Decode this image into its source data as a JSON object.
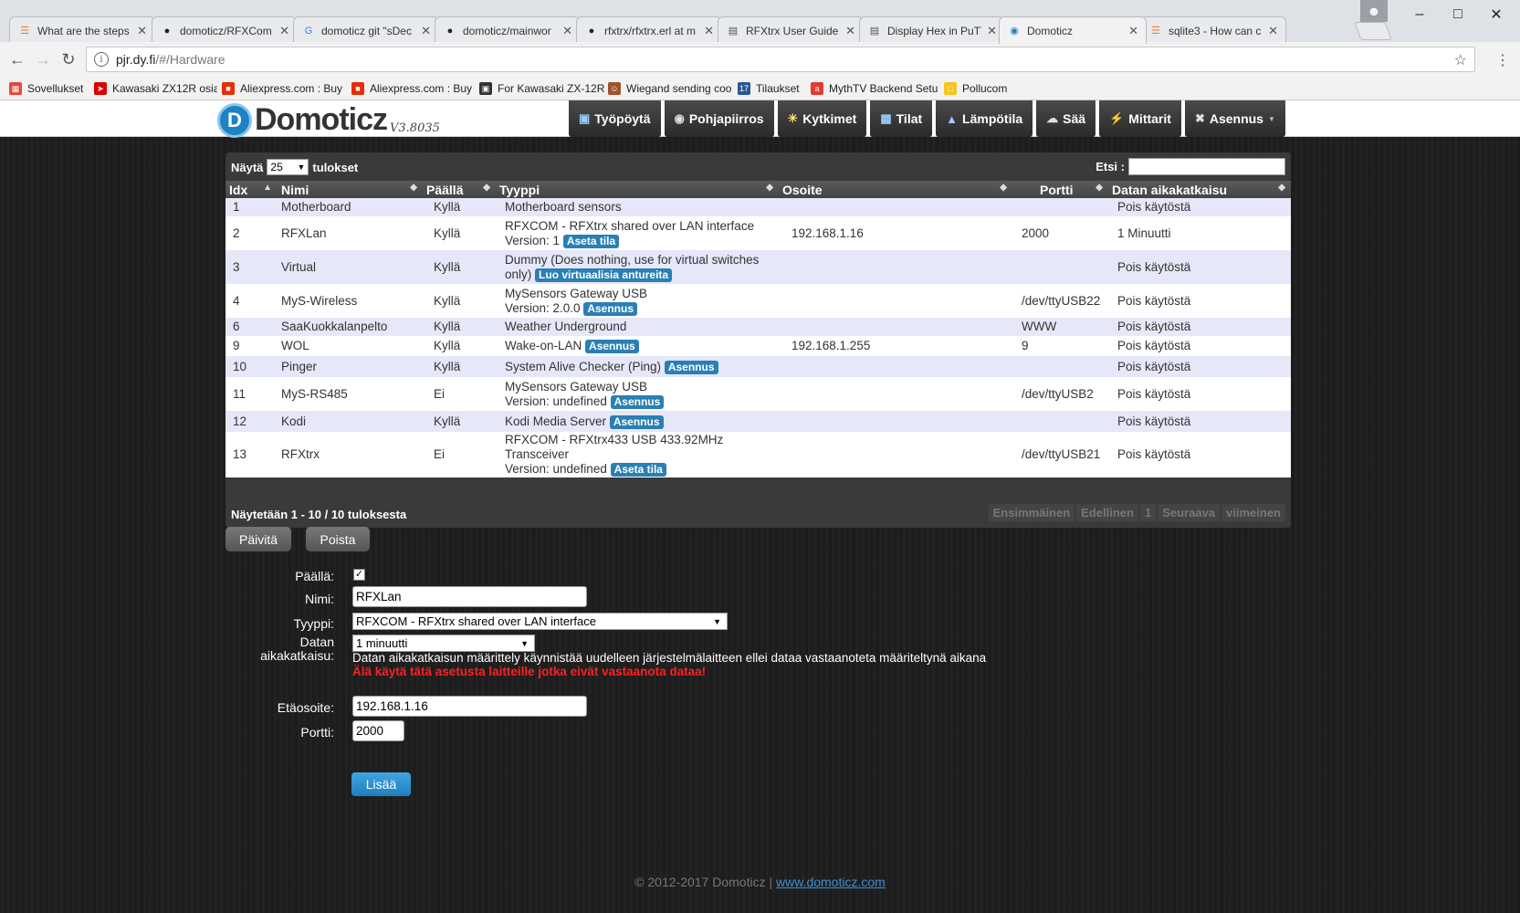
{
  "browser": {
    "tabs": [
      {
        "title": "What are the steps",
        "icon": "stackoverflow-icon"
      },
      {
        "title": "domoticz/RFXCom",
        "icon": "github-icon"
      },
      {
        "title": "domoticz git \"sDec",
        "icon": "google-icon"
      },
      {
        "title": "domoticz/mainwor",
        "icon": "github-icon"
      },
      {
        "title": "rfxtrx/rfxtrx.erl at m",
        "icon": "github-icon"
      },
      {
        "title": "RFXtrx User Guide",
        "icon": "document-icon"
      },
      {
        "title": "Display Hex in PuTT",
        "icon": "document-icon"
      },
      {
        "title": "Domoticz",
        "icon": "domoticz-icon"
      },
      {
        "title": "sqlite3 - How can c",
        "icon": "stackoverflow-icon"
      }
    ],
    "url_host": "pjr.dy.fi",
    "url_path": "/#/Hardware",
    "bookmarks": [
      {
        "label": "Sovellukset",
        "icon": "apps-grid-icon"
      },
      {
        "label": "Kawasaki ZX12R osia",
        "icon": "motorcycle-icon"
      },
      {
        "label": "Aliexpress.com : Buy",
        "icon": "aliexpress-icon"
      },
      {
        "label": "Aliexpress.com : Buy",
        "icon": "aliexpress-icon"
      },
      {
        "label": "For Kawasaki ZX-12R",
        "icon": "shop-icon"
      },
      {
        "label": "Wiegand sending coo",
        "icon": "person-icon"
      },
      {
        "label": "Tilaukset",
        "icon": "calendar-icon"
      },
      {
        "label": "MythTV Backend Setu",
        "icon": "ask-icon"
      },
      {
        "label": "Pollucom",
        "icon": "folder-icon"
      }
    ]
  },
  "app": {
    "logo_text": "Domoticz",
    "version": "V3.8035",
    "nav": [
      {
        "label": "Työpöytä",
        "icon": "dashboard-icon"
      },
      {
        "label": "Pohjapiirros",
        "icon": "floorplan-icon"
      },
      {
        "label": "Kytkimet",
        "icon": "lightbulb-icon"
      },
      {
        "label": "Tilat",
        "icon": "scene-icon"
      },
      {
        "label": "Lämpötila",
        "icon": "thermometer-icon"
      },
      {
        "label": "Sää",
        "icon": "weather-icon"
      },
      {
        "label": "Mittarit",
        "icon": "lightning-icon"
      },
      {
        "label": "Asennus",
        "icon": "tools-icon"
      }
    ]
  },
  "table": {
    "show_prefix": "Näytä",
    "page_size": "25",
    "show_suffix": "tulokset",
    "search_label": "Etsi :",
    "columns": [
      "Idx",
      "Nimi",
      "Päällä",
      "Tyyppi",
      "Osoite",
      "Portti",
      "Datan aikakatkaisu"
    ],
    "rows": [
      {
        "idx": "1",
        "name": "Motherboard",
        "enabled": "Kyllä",
        "type": "Motherboard sensors",
        "type2": "",
        "badge": "",
        "address": "",
        "port": "",
        "timeout": "Pois käytöstä"
      },
      {
        "idx": "2",
        "name": "RFXLan",
        "enabled": "Kyllä",
        "type": "RFXCOM - RFXtrx shared over LAN interface",
        "type2": "Version: 1",
        "badge": "Aseta tila",
        "address": "192.168.1.16",
        "port": "2000",
        "timeout": "1 Minuutti"
      },
      {
        "idx": "3",
        "name": "Virtual",
        "enabled": "Kyllä",
        "type": "Dummy (Does nothing, use for virtual switches",
        "type2": "only)",
        "badge": "Luo virtuaalisia antureita",
        "address": "",
        "port": "",
        "timeout": "Pois käytöstä"
      },
      {
        "idx": "4",
        "name": "MyS-Wireless",
        "enabled": "Kyllä",
        "type": "MySensors Gateway USB",
        "type2": "Version: 2.0.0",
        "badge": "Asennus",
        "address": "",
        "port": "/dev/ttyUSB22",
        "timeout": "Pois käytöstä"
      },
      {
        "idx": "6",
        "name": "SaaKuokkalanpelto",
        "enabled": "Kyllä",
        "type": "Weather Underground",
        "type2": "",
        "badge": "",
        "address": "",
        "port": "WWW",
        "timeout": "Pois käytöstä"
      },
      {
        "idx": "9",
        "name": "WOL",
        "enabled": "Kyllä",
        "type": "Wake-on-LAN",
        "type2": "",
        "badge": "Asennus",
        "address": "192.168.1.255",
        "port": "9",
        "timeout": "Pois käytöstä"
      },
      {
        "idx": "10",
        "name": "Pinger",
        "enabled": "Kyllä",
        "type": "System Alive Checker (Ping)",
        "type2": "",
        "badge": "Asennus",
        "address": "",
        "port": "",
        "timeout": "Pois käytöstä"
      },
      {
        "idx": "11",
        "name": "MyS-RS485",
        "enabled": "Ei",
        "type": "MySensors Gateway USB",
        "type2": "Version: undefined",
        "badge": "Asennus",
        "address": "",
        "port": "/dev/ttyUSB2",
        "timeout": "Pois käytöstä"
      },
      {
        "idx": "12",
        "name": "Kodi",
        "enabled": "Kyllä",
        "type": "Kodi Media Server",
        "type2": "",
        "badge": "Asennus",
        "address": "",
        "port": "",
        "timeout": "Pois käytöstä"
      },
      {
        "idx": "13",
        "name": "RFXtrx",
        "enabled": "Ei",
        "type": "RFXCOM - RFXtrx433 USB 433.92MHz",
        "type2": "Transceiver",
        "type3": "Version: undefined",
        "badge": "Aseta tila",
        "address": "",
        "port": "/dev/ttyUSB21",
        "timeout": "Pois käytöstä"
      }
    ],
    "info": "Näytetään 1 - 10 / 10 tuloksesta",
    "pager": [
      "Ensimmäinen",
      "Edellinen",
      "1",
      "Seuraava",
      "viimeinen"
    ]
  },
  "actions": {
    "update": "Päivitä",
    "delete": "Poista"
  },
  "form": {
    "enabled_label": "Päällä:",
    "enabled_checked": true,
    "name_label": "Nimi:",
    "name_value": "RFXLan",
    "type_label": "Tyyppi:",
    "type_value": "RFXCOM - RFXtrx shared over LAN interface",
    "timeout_label_1": "Datan",
    "timeout_label_2": "aikakatkaisu:",
    "timeout_value": "1 minuutti",
    "timeout_help": "Datan aikakatkaisun määrittely käynnistää uudelleen järjestelmälaitteen ellei dataa vastaanoteta määriteltynä aikana",
    "timeout_warning": "Älä käytä tätä asetusta laitteille jotka eivät vastaanota dataa!",
    "address_label": "Etäosoite:",
    "address_value": "192.168.1.16",
    "port_label": "Portti:",
    "port_value": "2000",
    "add_button": "Lisää"
  },
  "footer": {
    "copyright": "© 2012-2017 Domoticz |",
    "link": "www.domoticz.com"
  }
}
